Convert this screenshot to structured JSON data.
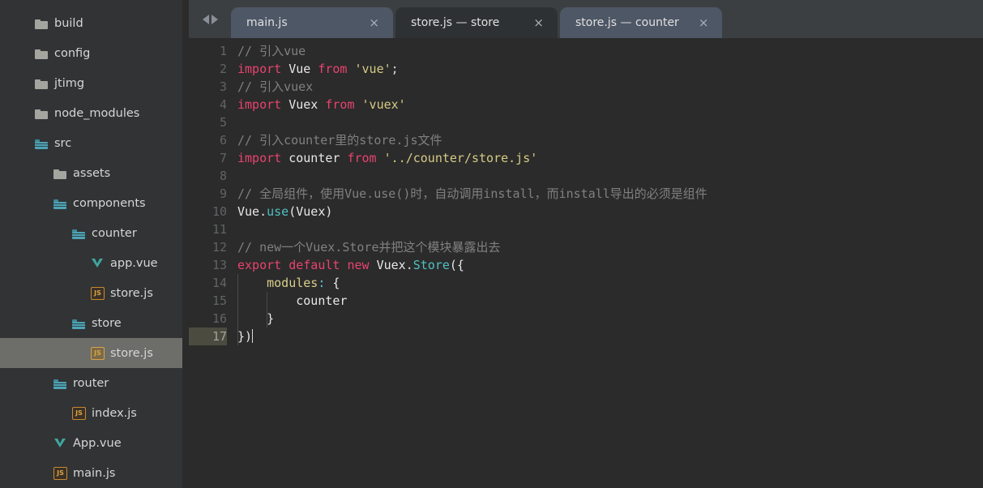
{
  "sidebar": {
    "items": [
      {
        "label": "build",
        "icon": "folder-icon",
        "depth": 1,
        "selected": false
      },
      {
        "label": "config",
        "icon": "folder-icon",
        "depth": 1,
        "selected": false
      },
      {
        "label": "jtimg",
        "icon": "folder-icon",
        "depth": 1,
        "selected": false
      },
      {
        "label": "node_modules",
        "icon": "folder-icon",
        "depth": 1,
        "selected": false
      },
      {
        "label": "src",
        "icon": "src-folder-icon",
        "depth": 1,
        "selected": false
      },
      {
        "label": "assets",
        "icon": "folder-icon",
        "depth": 2,
        "selected": false
      },
      {
        "label": "components",
        "icon": "src-folder-icon",
        "depth": 2,
        "selected": false
      },
      {
        "label": "counter",
        "icon": "src-folder-icon",
        "depth": 3,
        "selected": false
      },
      {
        "label": "app.vue",
        "icon": "vue-file-icon",
        "depth": 4,
        "selected": false
      },
      {
        "label": "store.js",
        "icon": "js-file-icon",
        "depth": 4,
        "selected": false
      },
      {
        "label": "store",
        "icon": "src-folder-icon",
        "depth": 3,
        "selected": false
      },
      {
        "label": "store.js",
        "icon": "js-file-icon",
        "depth": 4,
        "selected": true
      },
      {
        "label": "router",
        "icon": "src-folder-icon",
        "depth": 2,
        "selected": false
      },
      {
        "label": "index.js",
        "icon": "js-file-icon",
        "depth": 3,
        "selected": false
      },
      {
        "label": "App.vue",
        "icon": "vue-file-icon",
        "depth": 2,
        "selected": false
      },
      {
        "label": "main.js",
        "icon": "js-file-icon",
        "depth": 2,
        "selected": false
      }
    ]
  },
  "tabbar": {
    "nav_back": "back-arrow",
    "nav_forward": "forward-arrow",
    "close_glyph": "×",
    "tabs": [
      {
        "label": "main.js",
        "active": true
      },
      {
        "label": "store.js — store",
        "active": false
      },
      {
        "label": "store.js — counter",
        "active": true
      }
    ]
  },
  "editor": {
    "current_line": 17,
    "line_numbers": [
      "1",
      "2",
      "3",
      "4",
      "5",
      "6",
      "7",
      "8",
      "9",
      "10",
      "11",
      "12",
      "13",
      "14",
      "15",
      "16",
      "17"
    ],
    "lines": [
      {
        "n": 1,
        "tokens": [
          {
            "t": "// 引入vue",
            "c": "tok-cmt"
          }
        ]
      },
      {
        "n": 2,
        "tokens": [
          {
            "t": "import",
            "c": "tok-imp"
          },
          {
            "t": " ",
            "c": "tok-pun"
          },
          {
            "t": "Vue",
            "c": "tok-txt"
          },
          {
            "t": " ",
            "c": "tok-pun"
          },
          {
            "t": "from",
            "c": "tok-imp"
          },
          {
            "t": " ",
            "c": "tok-pun"
          },
          {
            "t": "'vue'",
            "c": "tok-str"
          },
          {
            "t": ";",
            "c": "tok-pun"
          }
        ]
      },
      {
        "n": 3,
        "tokens": [
          {
            "t": "// 引入vuex",
            "c": "tok-cmt"
          }
        ]
      },
      {
        "n": 4,
        "tokens": [
          {
            "t": "import",
            "c": "tok-imp"
          },
          {
            "t": " ",
            "c": "tok-pun"
          },
          {
            "t": "Vuex",
            "c": "tok-txt"
          },
          {
            "t": " ",
            "c": "tok-pun"
          },
          {
            "t": "from",
            "c": "tok-imp"
          },
          {
            "t": " ",
            "c": "tok-pun"
          },
          {
            "t": "'vuex'",
            "c": "tok-str"
          }
        ]
      },
      {
        "n": 5,
        "tokens": []
      },
      {
        "n": 6,
        "tokens": [
          {
            "t": "// 引入counter里的store.js文件",
            "c": "tok-cmt"
          }
        ]
      },
      {
        "n": 7,
        "tokens": [
          {
            "t": "import",
            "c": "tok-imp"
          },
          {
            "t": " ",
            "c": "tok-pun"
          },
          {
            "t": "counter",
            "c": "tok-txt"
          },
          {
            "t": " ",
            "c": "tok-pun"
          },
          {
            "t": "from",
            "c": "tok-imp"
          },
          {
            "t": " ",
            "c": "tok-pun"
          },
          {
            "t": "'../counter/store.js'",
            "c": "tok-str"
          }
        ]
      },
      {
        "n": 8,
        "tokens": []
      },
      {
        "n": 9,
        "tokens": [
          {
            "t": "// 全局组件，使用Vue.use()时，自动调用install，而install导出的必须是组件",
            "c": "tok-cmt"
          }
        ]
      },
      {
        "n": 10,
        "tokens": [
          {
            "t": "Vue",
            "c": "tok-txt"
          },
          {
            "t": ".",
            "c": "tok-pun"
          },
          {
            "t": "use",
            "c": "tok-fn"
          },
          {
            "t": "(Vue",
            "c": "tok-txt"
          },
          {
            "t": "x)",
            "c": "tok-txt"
          }
        ]
      },
      {
        "n": 11,
        "tokens": []
      },
      {
        "n": 12,
        "tokens": [
          {
            "t": "// new一个Vuex.Store并把这个模块暴露出去",
            "c": "tok-cmt"
          }
        ]
      },
      {
        "n": 13,
        "tokens": [
          {
            "t": "export",
            "c": "tok-imp"
          },
          {
            "t": " ",
            "c": "tok-pun"
          },
          {
            "t": "default",
            "c": "tok-imp"
          },
          {
            "t": " ",
            "c": "tok-pun"
          },
          {
            "t": "new",
            "c": "tok-imp"
          },
          {
            "t": " ",
            "c": "tok-pun"
          },
          {
            "t": "Vuex",
            "c": "tok-txt"
          },
          {
            "t": ".",
            "c": "tok-pun"
          },
          {
            "t": "Store",
            "c": "tok-cls"
          },
          {
            "t": "({",
            "c": "tok-txt"
          }
        ]
      },
      {
        "n": 14,
        "tokens": [
          {
            "t": "    ",
            "c": "tok-pun"
          },
          {
            "t": "modules",
            "c": "tok-prop"
          },
          {
            "t": ":",
            "c": "tok-op"
          },
          {
            "t": " {",
            "c": "tok-txt"
          }
        ]
      },
      {
        "n": 15,
        "tokens": [
          {
            "t": "        counter",
            "c": "tok-txt"
          }
        ]
      },
      {
        "n": 16,
        "tokens": [
          {
            "t": "    }",
            "c": "tok-txt"
          }
        ]
      },
      {
        "n": 17,
        "tokens": [
          {
            "t": "})",
            "c": "tok-txt"
          }
        ]
      }
    ]
  },
  "colors": {
    "sidebar_bg": "#313335",
    "editor_bg": "#2b2b2b",
    "tabbar_bg": "#3c3f41",
    "tab_active": "#4e5766",
    "tab_inactive": "#2e3133",
    "selection": "#6d6d6a",
    "comment": "#808080",
    "keyword": "#e8436f",
    "string": "#d6cb84",
    "function": "#4fc1c4",
    "text": "#e8e8e8",
    "line_number": "#606366",
    "current_line_gutter": "#4b4b3f",
    "js_icon": "#d9a441",
    "vue_icon": "#3fa7a0"
  }
}
